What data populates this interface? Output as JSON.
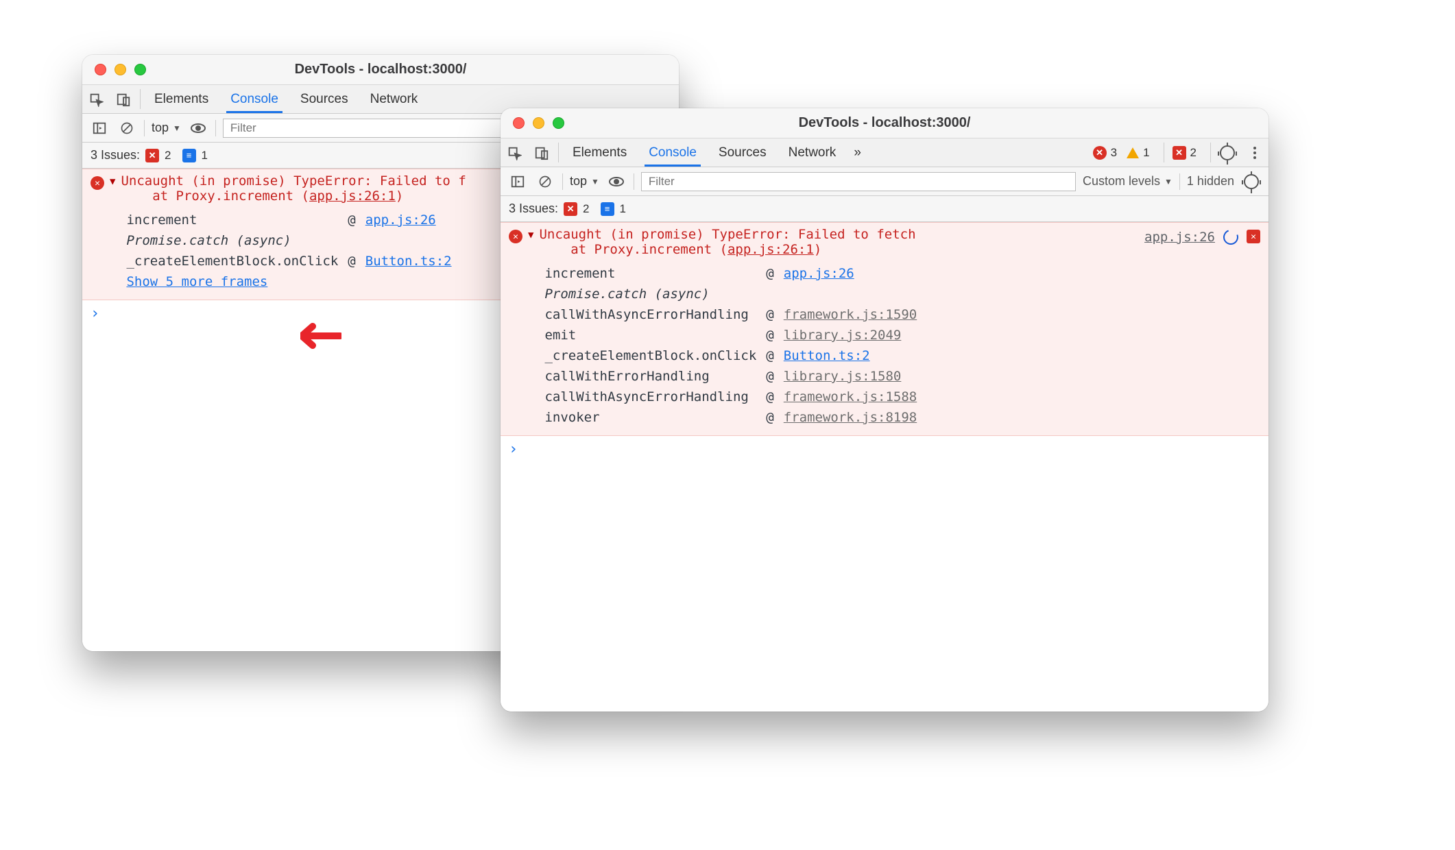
{
  "window1": {
    "title": "DevTools - localhost:3000/",
    "tabs": [
      "Elements",
      "Console",
      "Sources",
      "Network"
    ],
    "active_tab": "Console",
    "filter": {
      "scope": "top",
      "placeholder": "Filter"
    },
    "issues": {
      "label": "3 Issues:",
      "errors": "2",
      "messages": "1"
    },
    "error": {
      "message": "Uncaught (in promise) TypeError: Failed to f",
      "at_line": "at Proxy.increment (",
      "at_link": "app.js:26:1",
      "at_close": ")",
      "stack": [
        {
          "fn": "increment",
          "loc": "app.js:26",
          "first": false
        },
        {
          "fn": "Promise.catch (async)",
          "async": true
        },
        {
          "fn": "_createElementBlock.onClick",
          "loc": "Button.ts:2",
          "first": false
        }
      ],
      "show_more": "Show 5 more frames"
    }
  },
  "window2": {
    "title": "DevTools - localhost:3000/",
    "tabs": [
      "Elements",
      "Console",
      "Sources",
      "Network"
    ],
    "active_tab": "Console",
    "overflow": "»",
    "status_counts": {
      "errors": "3",
      "warnings": "1",
      "badge_errors": "2"
    },
    "filter": {
      "scope": "top",
      "placeholder": "Filter",
      "levels": "Custom levels",
      "hidden": "1 hidden"
    },
    "issues": {
      "label": "3 Issues:",
      "errors": "2",
      "messages": "1"
    },
    "error": {
      "message": "Uncaught (in promise) TypeError: Failed to fetch",
      "at_line": "at Proxy.increment (",
      "at_link": "app.js:26:1",
      "at_close": ")",
      "origin": "app.js:26",
      "stack": [
        {
          "fn": "increment",
          "loc": "app.js:26",
          "first": false
        },
        {
          "fn": "Promise.catch (async)",
          "async": true
        },
        {
          "fn": "callWithAsyncErrorHandling",
          "loc": "framework.js:1590",
          "third": true
        },
        {
          "fn": "emit",
          "loc": "library.js:2049",
          "third": true
        },
        {
          "fn": "_createElementBlock.onClick",
          "loc": "Button.ts:2",
          "first": false
        },
        {
          "fn": "callWithErrorHandling",
          "loc": "library.js:1580",
          "third": true
        },
        {
          "fn": "callWithAsyncErrorHandling",
          "loc": "framework.js:1588",
          "third": true
        },
        {
          "fn": "invoker",
          "loc": "framework.js:8198",
          "third": true
        }
      ]
    }
  }
}
